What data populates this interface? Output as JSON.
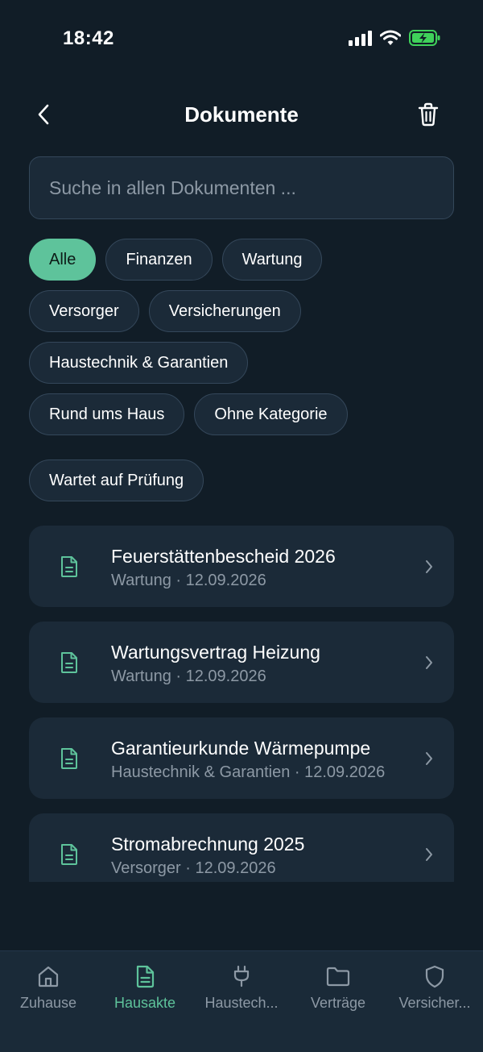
{
  "status_bar": {
    "time": "18:42"
  },
  "header": {
    "title": "Dokumente"
  },
  "search": {
    "placeholder": "Suche in allen Dokumenten ..."
  },
  "filters": [
    {
      "label": "Alle",
      "active": true
    },
    {
      "label": "Finanzen",
      "active": false
    },
    {
      "label": "Wartung",
      "active": false
    },
    {
      "label": "Versorger",
      "active": false
    },
    {
      "label": "Versicherungen",
      "active": false
    },
    {
      "label": "Haustechnik & Garantien",
      "active": false
    },
    {
      "label": "Rund ums Haus",
      "active": false
    },
    {
      "label": "Ohne Kategorie",
      "active": false
    },
    {
      "label": "Wartet auf Prüfung",
      "active": false
    }
  ],
  "documents": [
    {
      "title": "Feuerstättenbescheid 2026",
      "category": "Wartung",
      "date": "12.09.2026",
      "subtitle": "Wartung · 12.09.2026"
    },
    {
      "title": "Wartungsvertrag Heizung",
      "category": "Wartung",
      "date": "12.09.2026",
      "subtitle": "Wartung · 12.09.2026"
    },
    {
      "title": "Garantieurkunde Wärmepumpe",
      "category": "Haustechnik & Garantien",
      "date": "12.09.2026",
      "subtitle": "Haustechnik & Garantien · 12.09.2026"
    },
    {
      "title": "Stromabrechnung 2025",
      "category": "Versorger",
      "date": "12.09.2026",
      "subtitle": "Versorger · 12.09.2026"
    }
  ],
  "tabbar": [
    {
      "label": "Zuhause",
      "icon": "house-icon",
      "active": false
    },
    {
      "label": "Hausakte",
      "icon": "document-icon",
      "active": true
    },
    {
      "label": "Haustech...",
      "icon": "plug-icon",
      "active": false
    },
    {
      "label": "Verträge",
      "icon": "folder-icon",
      "active": false
    },
    {
      "label": "Versicher...",
      "icon": "shield-icon",
      "active": false
    }
  ],
  "colors": {
    "background": "#111d27",
    "card": "#1b2a38",
    "accent": "#5ec39b",
    "muted_text": "#8d99a5",
    "battery": "#3fd15a"
  }
}
